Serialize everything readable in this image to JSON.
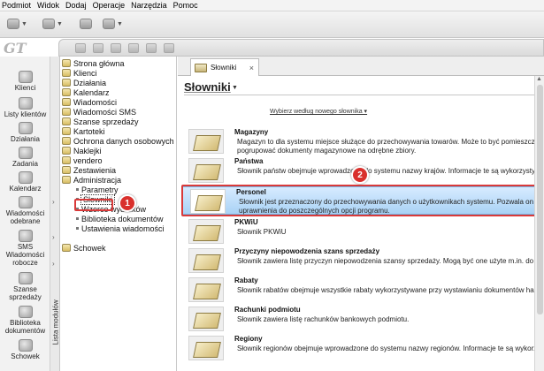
{
  "menu": [
    "Podmiot",
    "Widok",
    "Dodaj",
    "Operacje",
    "Narzędzia",
    "Pomoc"
  ],
  "logo": "GT",
  "left_modules": [
    {
      "label": "Klienci",
      "icon": "clients-icon"
    },
    {
      "label": "Listy klientów",
      "icon": "client-lists-icon"
    },
    {
      "label": "Działania",
      "icon": "actions-icon"
    },
    {
      "label": "Zadania",
      "icon": "tasks-icon"
    },
    {
      "label": "Kalendarz",
      "icon": "calendar-icon"
    },
    {
      "label": "Wiadomości odebrane",
      "icon": "inbox-icon"
    },
    {
      "label": "SMS Wiadomości robocze",
      "icon": "sms-icon"
    },
    {
      "label": "Szanse sprzedaży",
      "icon": "sales-opportunity-icon"
    },
    {
      "label": "Biblioteka dokumentów",
      "icon": "document-library-icon"
    },
    {
      "label": "Schowek",
      "icon": "clipboard-icon"
    }
  ],
  "module_strip_label": "Lista modułów",
  "tree": {
    "items": [
      "Strona główna",
      "Klienci",
      "Działania",
      "Kalendarz",
      "Wiadomości",
      "Wiadomości SMS",
      "Szanse sprzedaży",
      "Kartoteki",
      "Ochrona danych osobowych",
      "Naklejki",
      "vendero",
      "Zestawienia",
      "Administracja"
    ],
    "admin_children": [
      "Parametry",
      "Słowniki",
      "Wzorce wydruków",
      "Biblioteka dokumentów",
      "Ustawienia wiadomości"
    ],
    "last": "Schowek"
  },
  "callouts": [
    "1",
    "2"
  ],
  "tab": {
    "label": "Słowniki",
    "close": "×"
  },
  "page": {
    "title": "Słowniki",
    "hint": "Wybierz według nowego słownika ▾"
  },
  "dictionaries": [
    {
      "title": "Magazyny",
      "desc": [
        "Magazyn to dla systemu miejsce służące do przechowywania towarów. Może to być pomieszczenie, skl",
        "pogrupować dokumenty magazynowe na odrębne zbiory."
      ]
    },
    {
      "title": "Państwa",
      "desc": [
        "Słownik państw obejmuje wprowadzone do systemu nazwy krajów. Informacje te są wykorzystywane n"
      ]
    },
    {
      "title": "Personel",
      "desc": [
        "Słownik jest przeznaczony do przechowywania danych o użytkownikach systemu. Pozwala on użytkow",
        "uprawnienia do poszczególnych opcji programu."
      ]
    },
    {
      "title": "PKWiU",
      "desc": [
        "Słownik PKWiU"
      ]
    },
    {
      "title": "Przyczyny niepowodzenia szans sprzedaży",
      "desc": [
        "Słownik zawiera listę przyczyn niepowodzenia szansy sprzedaży. Mogą być one użyte m.in. do wyciąga"
      ]
    },
    {
      "title": "Rabaty",
      "desc": [
        "Słownik rabatów obejmuje wszystkie rabaty wykorzystywane przy wystawianiu dokumentów handlow"
      ]
    },
    {
      "title": "Rachunki podmiotu",
      "desc": [
        "Słownik zawiera listę rachunków bankowych podmiotu."
      ]
    },
    {
      "title": "Regiony",
      "desc": [
        "Słownik regionów obejmuje wprowadzone do systemu nazwy regionów. Informacje te są wykorzystywan"
      ]
    }
  ],
  "colors": {
    "highlight": "#a9d2f5",
    "callout": "#d9302c"
  }
}
